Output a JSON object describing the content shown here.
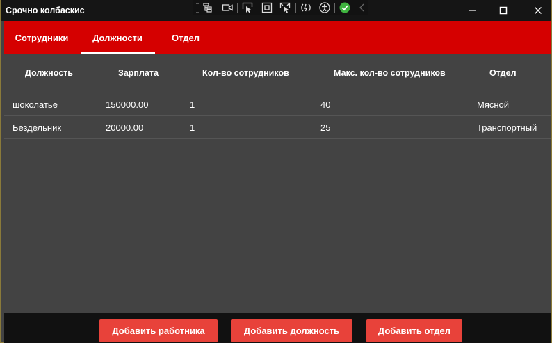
{
  "window": {
    "title": "Срочно колбаскис",
    "minimize_glyph": "—",
    "maximize_glyph": "☐",
    "close_glyph": "✕"
  },
  "debug_toolbar": {
    "icons": [
      "live-visual-tree-icon",
      "video-camera-icon",
      "select-element-icon",
      "display-layout-adorners-icon",
      "track-focused-element-icon",
      "hot-reload-icon",
      "accessibility-icon",
      "checkmark-icon",
      "collapse-chevron-icon"
    ]
  },
  "tabs": [
    {
      "label": "Сотрудники",
      "selected": false
    },
    {
      "label": "Должности",
      "selected": true
    },
    {
      "label": "Отдел",
      "selected": false
    }
  ],
  "grid": {
    "columns": [
      "Должность",
      "Зарплата",
      "Кол-во сотрудников",
      "Макс. кол-во сотрудников",
      "Отдел"
    ],
    "rows": [
      [
        "шоколатье",
        "150000.00",
        "1",
        "40",
        "Мясной"
      ],
      [
        "Бездельник",
        "20000.00",
        "1",
        "25",
        "Транспортный"
      ]
    ]
  },
  "actions": {
    "add_employee": "Добавить работника",
    "add_position": "Добавить должность",
    "add_department": "Добавить отдел"
  },
  "colors": {
    "accent_red": "#d50000",
    "button_red": "#e8423a",
    "content_bg": "#434343",
    "titlebar_bg": "#151515"
  }
}
